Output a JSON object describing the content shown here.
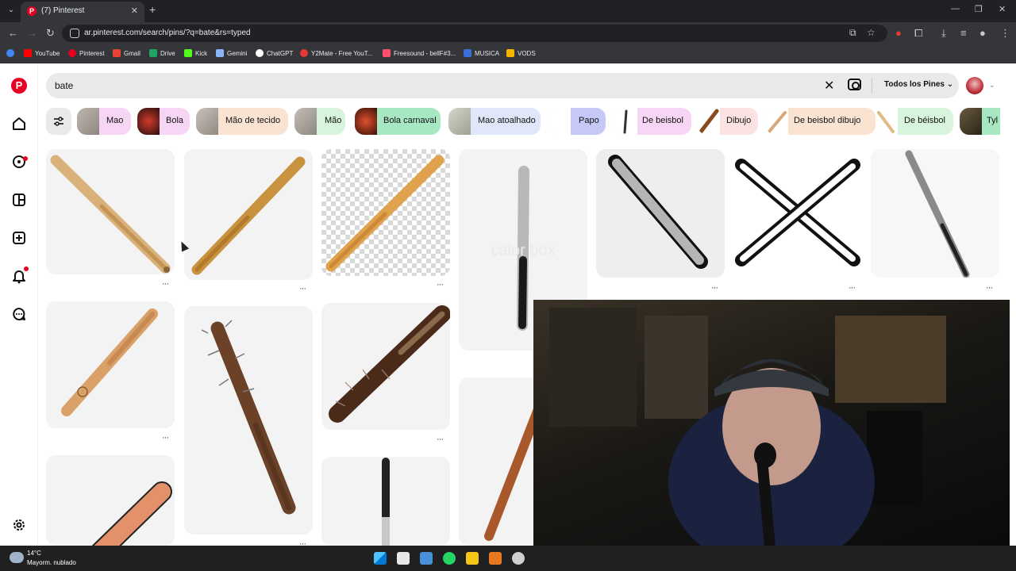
{
  "browser": {
    "tab_title": "(7) Pinterest",
    "url": "ar.pinterest.com/search/pins/?q=bate&rs=typed",
    "bookmarks": [
      {
        "label": "YouTube",
        "color": "#ff0000"
      },
      {
        "label": "Pinterest",
        "color": "#e60023"
      },
      {
        "label": "Gmail",
        "color": "#ea4335"
      },
      {
        "label": "Drive",
        "color": "#1fa463"
      },
      {
        "label": "Kick",
        "color": "#53fc18"
      },
      {
        "label": "Gemini",
        "color": "#8ab4f8"
      },
      {
        "label": "ChatGPT",
        "color": "#ffffff"
      },
      {
        "label": "Y2Mate - Free YouT...",
        "color": "#e53935"
      },
      {
        "label": "Freesound - bellF#3...",
        "color": "#ff4f6d"
      },
      {
        "label": "MUSICA",
        "color": "#3a6fd8"
      },
      {
        "label": "VODS",
        "color": "#f4b400"
      }
    ]
  },
  "search": {
    "query": "bate",
    "filter_label": "Todos los Pines"
  },
  "chips": [
    {
      "label": "Mao",
      "bg": "#f6d6f4"
    },
    {
      "label": "Bola",
      "bg": "#f6d6f4"
    },
    {
      "label": "Mão de tecido",
      "bg": "#fbe3d1"
    },
    {
      "label": "Mão",
      "bg": "#d9f4dc"
    },
    {
      "label": "Bola carnaval",
      "bg": "#a7e7c1"
    },
    {
      "label": "Mao atoalhado",
      "bg": "#e1e7fb"
    },
    {
      "label": "Papo",
      "bg": "#c6c9f7"
    },
    {
      "label": "De beisbol",
      "bg": "#f6d6f4"
    },
    {
      "label": "Dibujo",
      "bg": "#fbe3e3"
    },
    {
      "label": "De beisbol dibujo",
      "bg": "#fbe3d1"
    },
    {
      "label": "De béisbol",
      "bg": "#d9f4dc"
    },
    {
      "label": "Tyl",
      "bg": "#a7e7c1"
    }
  ],
  "webcam": {
    "watermark": "calor box"
  },
  "taskbar": {
    "temperature": "14°C",
    "weather": "Mayorm. nublado"
  },
  "colors": {
    "brand": "#e60023",
    "search_bg": "#e9e9e9"
  }
}
